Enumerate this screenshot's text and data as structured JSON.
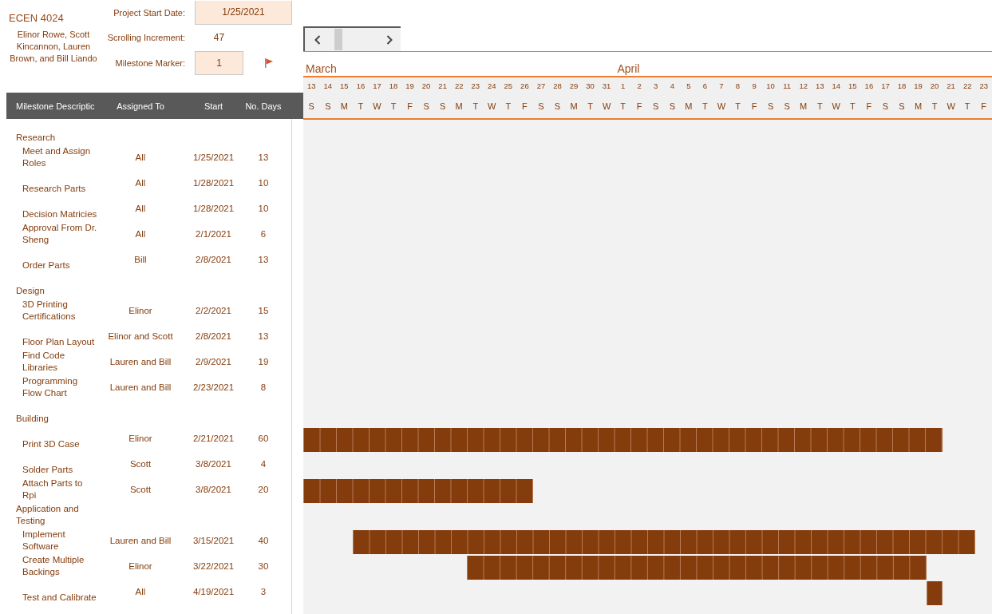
{
  "header": {
    "course": "ECEN 4024",
    "team": "Elinor Rowe, Scott Kincannon, Lauren Brown, and Bill Liando"
  },
  "settings": {
    "project_start": {
      "label": "Project Start Date:",
      "value": "1/25/2021"
    },
    "scrolling_increment": {
      "label": "Scrolling Increment:",
      "value": "47"
    },
    "milestone_marker": {
      "label": "Milestone Marker:",
      "value": "1"
    }
  },
  "timeline": {
    "days": [
      {
        "date": "13",
        "weekday": "S",
        "month": "March"
      },
      {
        "date": "14",
        "weekday": "S"
      },
      {
        "date": "15",
        "weekday": "M"
      },
      {
        "date": "16",
        "weekday": "T"
      },
      {
        "date": "17",
        "weekday": "W"
      },
      {
        "date": "18",
        "weekday": "T"
      },
      {
        "date": "19",
        "weekday": "F"
      },
      {
        "date": "20",
        "weekday": "S"
      },
      {
        "date": "21",
        "weekday": "S"
      },
      {
        "date": "22",
        "weekday": "M"
      },
      {
        "date": "23",
        "weekday": "T"
      },
      {
        "date": "24",
        "weekday": "W"
      },
      {
        "date": "25",
        "weekday": "T"
      },
      {
        "date": "26",
        "weekday": "F"
      },
      {
        "date": "27",
        "weekday": "S"
      },
      {
        "date": "28",
        "weekday": "S"
      },
      {
        "date": "29",
        "weekday": "M"
      },
      {
        "date": "30",
        "weekday": "T"
      },
      {
        "date": "31",
        "weekday": "W"
      },
      {
        "date": "1",
        "weekday": "T",
        "month": "April"
      },
      {
        "date": "2",
        "weekday": "F"
      },
      {
        "date": "3",
        "weekday": "S"
      },
      {
        "date": "4",
        "weekday": "S"
      },
      {
        "date": "5",
        "weekday": "M"
      },
      {
        "date": "6",
        "weekday": "T"
      },
      {
        "date": "7",
        "weekday": "W"
      },
      {
        "date": "8",
        "weekday": "T"
      },
      {
        "date": "9",
        "weekday": "F"
      },
      {
        "date": "10",
        "weekday": "S"
      },
      {
        "date": "11",
        "weekday": "S"
      },
      {
        "date": "12",
        "weekday": "M"
      },
      {
        "date": "13",
        "weekday": "T"
      },
      {
        "date": "14",
        "weekday": "W"
      },
      {
        "date": "15",
        "weekday": "T"
      },
      {
        "date": "16",
        "weekday": "F"
      },
      {
        "date": "17",
        "weekday": "S"
      },
      {
        "date": "18",
        "weekday": "S"
      },
      {
        "date": "19",
        "weekday": "M"
      },
      {
        "date": "20",
        "weekday": "T"
      },
      {
        "date": "21",
        "weekday": "W"
      },
      {
        "date": "22",
        "weekday": "T"
      },
      {
        "date": "23",
        "weekday": "F"
      }
    ]
  },
  "table": {
    "columns": [
      "Milestone Descriptic",
      "Assigned To",
      "Start",
      "No. Days"
    ],
    "groups": [
      {
        "name": "Research",
        "tasks": [
          {
            "description": "Meet and Assign Roles",
            "assigned": "All",
            "start": "1/25/2021",
            "days": "13"
          },
          {
            "description": "Research Parts",
            "assigned": "All",
            "start": "1/28/2021",
            "days": "10"
          },
          {
            "description": "Decision Matricies",
            "assigned": "All",
            "start": "1/28/2021",
            "days": "10"
          },
          {
            "description": "Approval From Dr. Sheng",
            "assigned": "All",
            "start": "2/1/2021",
            "days": "6"
          },
          {
            "description": "Order Parts",
            "assigned": "Bill",
            "start": "2/8/2021",
            "days": "13"
          }
        ]
      },
      {
        "name": "Design",
        "tasks": [
          {
            "description": "3D Printing Certifications",
            "assigned": "Elinor",
            "start": "2/2/2021",
            "days": "15"
          },
          {
            "description": "Floor Plan Layout",
            "assigned": "Elinor and Scott",
            "start": "2/8/2021",
            "days": "13"
          },
          {
            "description": "Find Code Libraries",
            "assigned": "Lauren and Bill",
            "start": "2/9/2021",
            "days": "19"
          },
          {
            "description": "Programming Flow Chart",
            "assigned": "Lauren and Bill",
            "start": "2/23/2021",
            "days": "8"
          }
        ]
      },
      {
        "name": "Building",
        "tasks": [
          {
            "description": "Print 3D Case",
            "assigned": "Elinor",
            "start": "2/21/2021",
            "days": "60"
          },
          {
            "description": "Solder Parts",
            "assigned": "Scott",
            "start": "3/8/2021",
            "days": "4"
          },
          {
            "description": "Attach Parts to Rpi",
            "assigned": "Scott",
            "start": "3/8/2021",
            "days": "20"
          }
        ]
      },
      {
        "name": "Application and Testing",
        "tasks": [
          {
            "description": "Implement Software",
            "assigned": "Lauren and Bill",
            "start": "3/15/2021",
            "days": "40"
          },
          {
            "description": "Create Multiple Backings",
            "assigned": "Elinor",
            "start": "3/22/2021",
            "days": "30"
          },
          {
            "description": "Test and Calibrate",
            "assigned": "All",
            "start": "4/19/2021",
            "days": "3"
          }
        ]
      }
    ]
  }
}
